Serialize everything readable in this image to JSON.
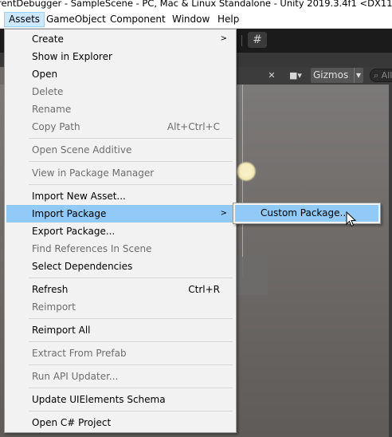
{
  "window": {
    "title": "rentDebugger - SampleScene - PC, Mac & Linux Standalone - Unity 2019.3.4f1 <DX11>"
  },
  "menubar": [
    "Assets",
    "GameObject",
    "Component",
    "Window",
    "Help"
  ],
  "scene_toolbar": {
    "gizmos": "Gizmos",
    "search_placeholder": "All"
  },
  "assets_menu": [
    {
      "label": "Create",
      "submenu": true
    },
    {
      "label": "Show in Explorer"
    },
    {
      "label": "Open"
    },
    {
      "label": "Delete",
      "disabled": true
    },
    {
      "label": "Rename",
      "disabled": true
    },
    {
      "label": "Copy Path",
      "shortcut": "Alt+Ctrl+C",
      "disabled": true
    },
    {
      "label": "Open Scene Additive",
      "disabled": true
    },
    {
      "label": "View in Package Manager",
      "disabled": true
    },
    {
      "label": "Import New Asset..."
    },
    {
      "label": "Import Package",
      "submenu": true,
      "highlighted": true
    },
    {
      "label": "Export Package..."
    },
    {
      "label": "Find References In Scene",
      "disabled": true
    },
    {
      "label": "Select Dependencies"
    },
    {
      "label": "Refresh",
      "shortcut": "Ctrl+R"
    },
    {
      "label": "Reimport",
      "disabled": true
    },
    {
      "label": "Reimport All"
    },
    {
      "label": "Extract From Prefab",
      "disabled": true
    },
    {
      "label": "Run API Updater...",
      "disabled": true
    },
    {
      "label": "Update UIElements Schema"
    },
    {
      "label": "Open C# Project"
    }
  ],
  "import_package_submenu": {
    "custom_package": "Custom Package..."
  },
  "colors": {
    "highlight": "#91c9f7",
    "menubar_active": "#cce8ff",
    "scene_bg": "#6e6b68"
  }
}
